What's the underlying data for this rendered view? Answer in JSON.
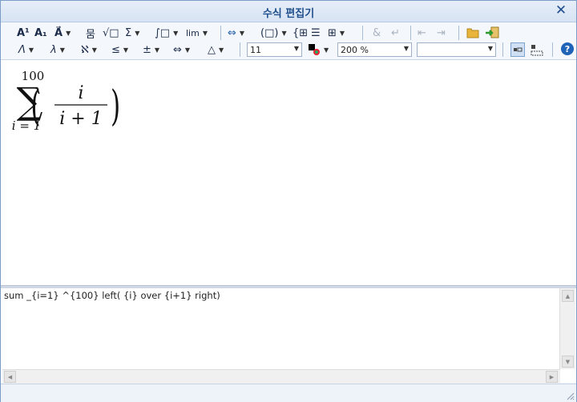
{
  "window": {
    "title": "수식 편집기"
  },
  "toolbar_row1": [
    {
      "name": "superscript-button",
      "label": "A¹",
      "drop": false
    },
    {
      "name": "subscript-button",
      "label": "A₁",
      "drop": false
    },
    {
      "name": "accent-button",
      "label": "A⃗",
      "drop": true
    },
    {
      "name": "fraction-button",
      "label": "뭄",
      "drop": false
    },
    {
      "name": "root-button",
      "label": "√□",
      "drop": false
    },
    {
      "name": "sum-button",
      "label": "Σ",
      "drop": true
    },
    {
      "name": "integral-button",
      "label": "∫□",
      "drop": true
    },
    {
      "name": "limit-button",
      "label": "lim",
      "drop": true
    },
    {
      "name": "arrow-button",
      "label": "⇔",
      "drop": true
    },
    {
      "name": "paren-button",
      "label": "(□)",
      "drop": true
    },
    {
      "name": "matrix-case-button",
      "label": "{⊞",
      "drop": false
    },
    {
      "name": "vertical-stack-button",
      "label": "☰",
      "drop": false
    },
    {
      "name": "matrix-button",
      "label": "⊞",
      "drop": true
    },
    {
      "name": "align-button",
      "label": "&",
      "drop": false
    },
    {
      "name": "newline-button",
      "label": "↵",
      "drop": false
    },
    {
      "name": "prev-button",
      "label": "⇤",
      "drop": false
    },
    {
      "name": "next-button",
      "label": "⇥",
      "drop": false
    },
    {
      "name": "open-button",
      "label": "📂",
      "drop": false
    },
    {
      "name": "insert-button",
      "label": "➜",
      "drop": false
    }
  ],
  "toolbar_row2": [
    {
      "name": "greek-upper-button",
      "label": "Λ"
    },
    {
      "name": "greek-lower-button",
      "label": "λ"
    },
    {
      "name": "special-char-button",
      "label": "ℵ"
    },
    {
      "name": "relation-button",
      "label": "≤"
    },
    {
      "name": "operator-button",
      "label": "±"
    },
    {
      "name": "arrow2-button",
      "label": "⇔"
    },
    {
      "name": "misc-symbol-button",
      "label": "△"
    }
  ],
  "font_size": {
    "value": "11"
  },
  "zoom": {
    "value": "200 %"
  },
  "font_combo": {
    "value": ""
  },
  "script": "sum _{i=1} ^{100} left( {i} over {i+1} right)",
  "formula": {
    "sum_upper": "100",
    "sum_lower": "i = 1",
    "numerator": "i",
    "denominator": "i + 1"
  },
  "help_label": "?"
}
